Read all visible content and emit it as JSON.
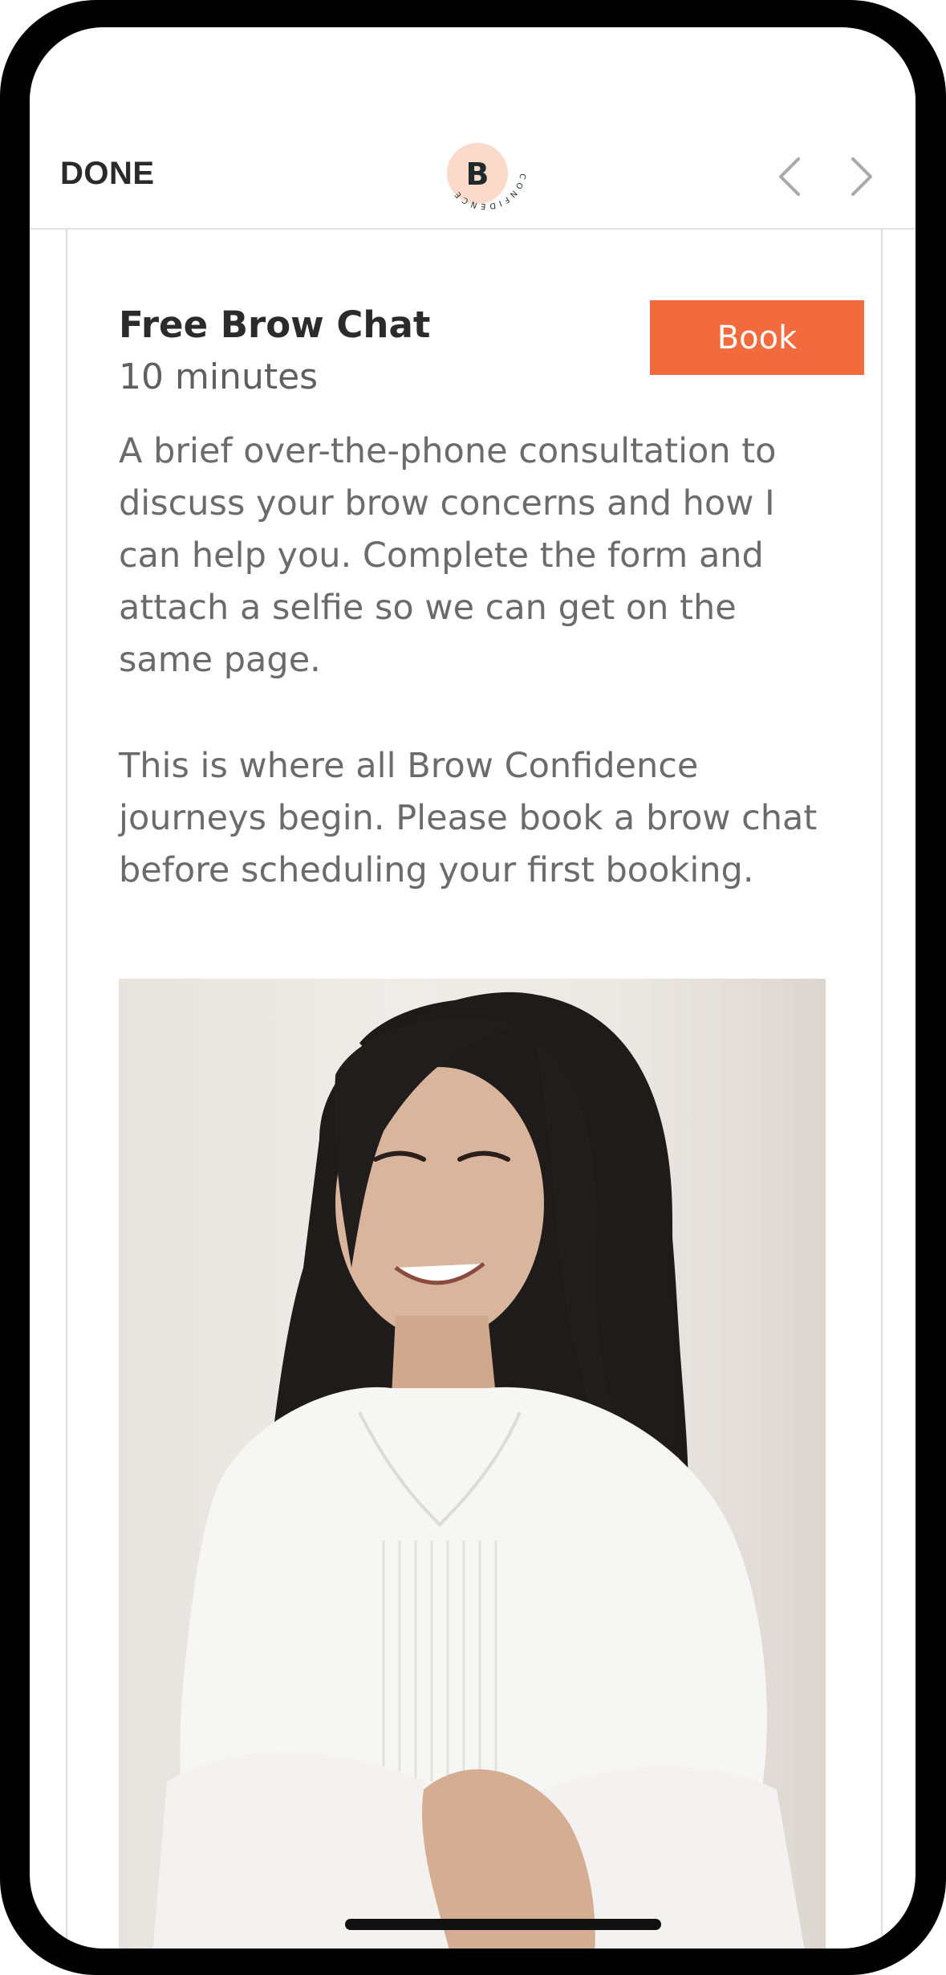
{
  "navbar": {
    "done_label": "DONE",
    "logo": {
      "icon": "brow-confidence-logo-icon",
      "letter": "B",
      "ring_text": "CONFIDENCE"
    },
    "prev_icon": "chevron-left-icon",
    "next_icon": "chevron-right-icon"
  },
  "service": {
    "title": "Free Brow Chat",
    "duration": "10 minutes",
    "book_label": "Book",
    "description_1": "A brief over-the-phone consultation to discuss your brow concerns and how I can help you. Complete the form and attach a selfie so we can get on the same page.",
    "description_2": "This is where all Brow Confidence journeys begin. Please book a brow chat before scheduling your first booking."
  },
  "colors": {
    "accent": "#f26b3f",
    "logo_circle": "#fbd9cb",
    "text_dark": "#2b2b2b",
    "text_muted": "#6b6b6b"
  }
}
